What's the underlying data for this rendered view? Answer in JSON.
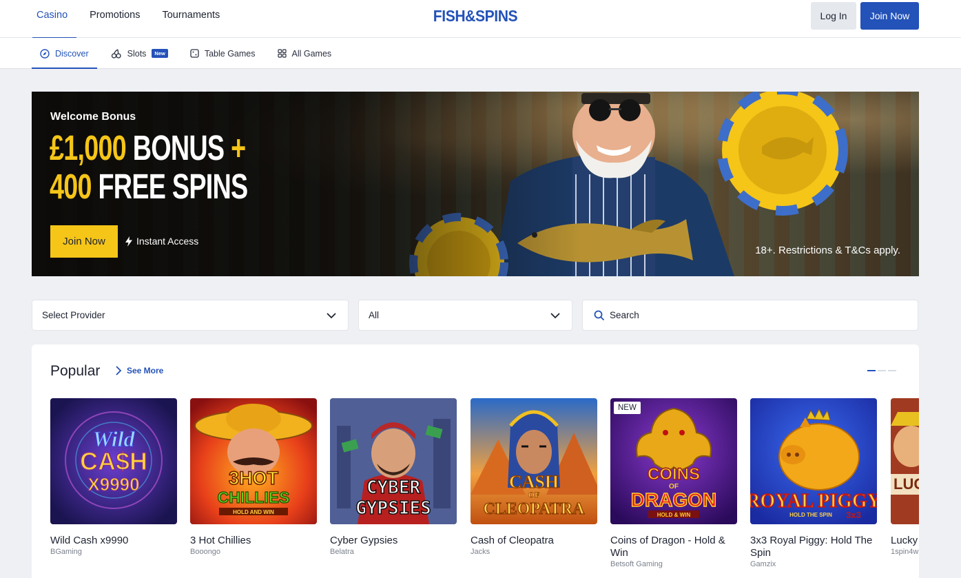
{
  "header": {
    "nav": [
      {
        "label": "Casino",
        "active": true
      },
      {
        "label": "Promotions"
      },
      {
        "label": "Tournaments"
      }
    ],
    "logo": "FISH&SPINS",
    "login_label": "Log In",
    "join_label": "Join Now"
  },
  "subnav": {
    "items": [
      {
        "label": "Discover",
        "icon": "compass-icon",
        "active": true
      },
      {
        "label": "Slots",
        "icon": "cherries-icon",
        "badge": "New"
      },
      {
        "label": "Table Games",
        "icon": "dice-icon"
      },
      {
        "label": "All Games",
        "icon": "grid-icon"
      }
    ]
  },
  "banner": {
    "subtitle": "Welcome Bonus",
    "line1_gold": "£1,000",
    "line1_white": "BONUS",
    "line1_plus": "+",
    "line2_gold": "400",
    "line2_white": "FREE SPINS",
    "cta": "Join Now",
    "instant": "Instant Access",
    "terms": "18+. Restrictions & T&Cs apply.",
    "colors": {
      "gold": "#f5c518"
    }
  },
  "filters": {
    "provider": "Select Provider",
    "type": "All",
    "search_label": "Search"
  },
  "popular": {
    "title": "Popular",
    "see_more": "See More",
    "games": [
      {
        "name": "Wild Cash x9990",
        "provider": "BGaming",
        "art": "Wild CA$H x9990"
      },
      {
        "name": "3 Hot Chillies",
        "provider": "Booongo",
        "art": "3 HOT CHILLIES",
        "art_sub": "HOLD AND WIN"
      },
      {
        "name": "Cyber Gypsies",
        "provider": "Belatra",
        "art": "CYBER GYPSIES"
      },
      {
        "name": "Cash of Cleopatra",
        "provider": "Jacks",
        "art": "CASH of CLEOPATRA"
      },
      {
        "name": "Coins of Dragon - Hold & Win",
        "provider": "Betsoft Gaming",
        "badge": "NEW",
        "art": "COINS of DRAGON",
        "art_sub": "HOLD & WIN"
      },
      {
        "name": "3x3 Royal Piggy: Hold The Spin",
        "provider": "Gamzix",
        "art": "ROYAL PIGGY",
        "art_sub": "HOLD THE SPIN"
      },
      {
        "name": "Lucky Win",
        "provider": "1spin4w",
        "art": "LUC"
      }
    ]
  },
  "brand_color": "#2352b8"
}
